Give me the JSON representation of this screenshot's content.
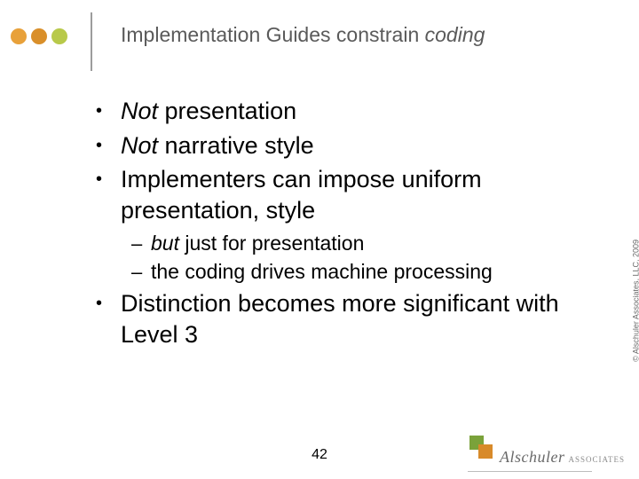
{
  "title": {
    "prefix": "Implementation Guides constrain ",
    "italic": "coding"
  },
  "bullets": {
    "b1": {
      "em": "Not",
      "rest": " presentation"
    },
    "b2": {
      "em": "Not",
      "rest": " narrative style"
    },
    "b3": "Implementers can impose uniform presentation, style",
    "sub": {
      "s1": {
        "em": "but",
        "rest": " just for presentation"
      },
      "s2": "the coding drives machine processing"
    },
    "b4": "Distinction becomes more significant with Level 3"
  },
  "pagenum": "42",
  "copyright": "© Alschuler Associates, LLC, 2009",
  "logo": {
    "name": "Alschuler",
    "sub": "ASSOCIATES"
  }
}
